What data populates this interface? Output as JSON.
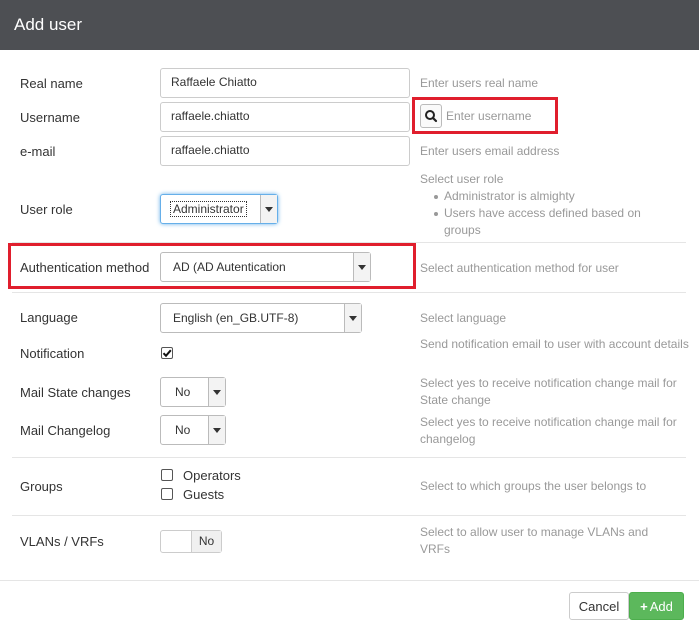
{
  "modal": {
    "title": "Add user"
  },
  "fields": {
    "real_name": {
      "label": "Real name",
      "value": "Raffaele Chiatto",
      "help": "Enter users real name"
    },
    "username": {
      "label": "Username",
      "value": "raffaele.chiatto",
      "search_placeholder": "Enter username"
    },
    "email": {
      "label": "e-mail",
      "value": "raffaele.chiatto",
      "help": "Enter users email address"
    },
    "user_role": {
      "label": "User role",
      "value": "Administrator",
      "help_title": "Select user role",
      "help_items": [
        "Administrator is almighty",
        "Users have access defined based on groups"
      ]
    },
    "auth_method": {
      "label": "Authentication method",
      "value": "AD (AD Autentication",
      "help": "Select authentication method for user"
    },
    "language": {
      "label": "Language",
      "value": "English (en_GB.UTF-8)",
      "help": "Select language"
    },
    "notification": {
      "label": "Notification",
      "checked": true,
      "help": "Send notification email to user with account details"
    },
    "mail_state": {
      "label": "Mail State changes",
      "value": "No",
      "help": "Select yes to receive notification change mail for State change"
    },
    "mail_changelog": {
      "label": "Mail Changelog",
      "value": "No",
      "help": "Select yes to receive notification change mail for changelog"
    },
    "groups": {
      "label": "Groups",
      "items": [
        {
          "name": "Operators",
          "checked": false
        },
        {
          "name": "Guests",
          "checked": false
        }
      ],
      "help": "Select to which groups the user belongs to"
    },
    "vlans": {
      "label": "VLANs / VRFs",
      "value": "No",
      "help": "Select to allow user to manage VLANs and VRFs"
    }
  },
  "footer": {
    "cancel_label": "Cancel",
    "add_label": "Add"
  },
  "colors": {
    "header_bg": "#4d4f53",
    "highlight": "#e01e2d",
    "add_button": "#5cb85c"
  }
}
